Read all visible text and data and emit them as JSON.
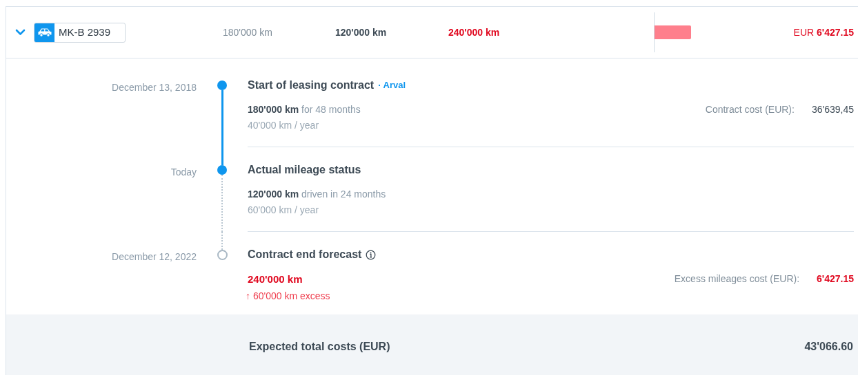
{
  "vehicle_row": {
    "expanded": true,
    "plate": "MK-B 2939",
    "contract_km": "180'000 km",
    "actual_km": "120'000 km",
    "forecast_km": "240'000 km",
    "cost_currency": "EUR",
    "cost": "6'427.15"
  },
  "timeline": [
    {
      "date": "December 13, 2018",
      "reached": true,
      "title": "Start of leasing contract",
      "provider": "· Arval",
      "km": "180'000 km",
      "km_note": "for 48 months",
      "km_alert": false,
      "rate": "40'000 km / year",
      "cost_label": "Contract cost (EUR):",
      "cost_value": "36'639,45",
      "cost_alert": false
    },
    {
      "date": "Today",
      "reached": true,
      "title": "Actual mileage status",
      "km": "120'000 km",
      "km_note": "driven in 24 months",
      "km_alert": false,
      "rate": "60'000 km / year"
    },
    {
      "date": "December 12, 2022",
      "reached": false,
      "title": "Contract end forecast",
      "info": true,
      "km": "240'000 km",
      "km_alert": true,
      "excess": "↑ 60'000 km excess",
      "cost_label": "Excess mileages cost (EUR):",
      "cost_value": "6'427.15",
      "cost_alert": true
    }
  ],
  "total": {
    "label": "Expected total costs (EUR)",
    "value": "43'066.60"
  }
}
